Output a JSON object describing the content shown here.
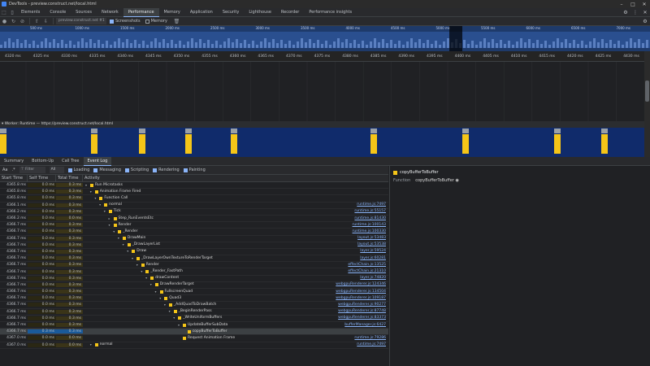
{
  "window": {
    "title": "DevTools - preview.construct.net/local.html"
  },
  "tabs": [
    "Elements",
    "Console",
    "Sources",
    "Network",
    "Performance",
    "Memory",
    "Application",
    "Security",
    "Lighthouse",
    "Recorder",
    "Performance insights"
  ],
  "active_tab": "Performance",
  "toolbar": {
    "url": "preview.construct.net #1",
    "screenshots_label": "Screenshots",
    "memory_label": "Memory"
  },
  "overview_ticks": [
    "500 ms",
    "1000 ms",
    "1500 ms",
    "2000 ms",
    "2500 ms",
    "3000 ms",
    "3500 ms",
    "4000 ms",
    "4500 ms",
    "5000 ms",
    "5500 ms",
    "6000 ms",
    "6500 ms",
    "7000 ms"
  ],
  "ruler_ticks": [
    "4320 ms",
    "4325 ms",
    "4330 ms",
    "4335 ms",
    "4340 ms",
    "4345 ms",
    "4350 ms",
    "4355 ms",
    "4360 ms",
    "4365 ms",
    "4370 ms",
    "4375 ms",
    "4380 ms",
    "4385 ms",
    "4390 ms",
    "4395 ms",
    "4400 ms",
    "4405 ms",
    "4410 ms",
    "4415 ms",
    "4420 ms",
    "4425 ms",
    "4430 ms"
  ],
  "worker_track": {
    "label": "Worker: Runtime — https://preview.construct.net/local.html"
  },
  "bottom_tabs": [
    "Summary",
    "Bottom-Up",
    "Call Tree",
    "Event Log"
  ],
  "active_bottom_tab": "Event Log",
  "filter": {
    "case_label": "Aa",
    "regex_label": ".*",
    "filter_placeholder": "Filter",
    "select_value": "All",
    "checks": [
      "Loading",
      "Messaging",
      "Scripting",
      "Rendering",
      "Painting"
    ]
  },
  "table": {
    "headers": [
      "Start Time",
      "Self Time",
      "Total Time",
      "Activity"
    ],
    "rows": [
      {
        "start": "4365.8 ms",
        "self": "0.0 ms",
        "total": "0.3 ms",
        "depth": 0,
        "name": "Run Microtasks",
        "src": ""
      },
      {
        "start": "4365.8 ms",
        "self": "0.0 ms",
        "total": "0.3 ms",
        "depth": 1,
        "name": "Animation Frame Fired",
        "src": ""
      },
      {
        "start": "4365.8 ms",
        "self": "0.0 ms",
        "total": "0.3 ms",
        "depth": 2,
        "name": "Function Call",
        "src": ""
      },
      {
        "start": "4366.1 ms",
        "self": "0.0 ms",
        "total": "0.3 ms",
        "depth": 3,
        "name": "normal",
        "src": "runtime.js:7497"
      },
      {
        "start": "4366.2 ms",
        "self": "0.0 ms",
        "total": "0.3 ms",
        "depth": 4,
        "name": "Tick",
        "src": "runtime.js:55157"
      },
      {
        "start": "4366.2 ms",
        "self": "0.0 ms",
        "total": "0.0 ms",
        "depth": 5,
        "name": "Step_RunEventsEtc",
        "src": "runtime.js:81430"
      },
      {
        "start": "4366.7 ms",
        "self": "0.0 ms",
        "total": "0.3 ms",
        "depth": 5,
        "name": "Render",
        "src": "runtime.js:100143"
      },
      {
        "start": "4366.7 ms",
        "self": "0.0 ms",
        "total": "0.3 ms",
        "depth": 6,
        "name": "_Render",
        "src": "runtime.js:100330"
      },
      {
        "start": "4366.7 ms",
        "self": "0.0 ms",
        "total": "0.3 ms",
        "depth": 7,
        "name": "DrawMain",
        "src": "layout.js:53483"
      },
      {
        "start": "4366.7 ms",
        "self": "0.0 ms",
        "total": "0.3 ms",
        "depth": 8,
        "name": "_DrawLayerList",
        "src": "layout.js:53538"
      },
      {
        "start": "4366.7 ms",
        "self": "0.0 ms",
        "total": "0.3 ms",
        "depth": 9,
        "name": "Draw",
        "src": "layer.js:59524"
      },
      {
        "start": "4366.7 ms",
        "self": "0.0 ms",
        "total": "0.3 ms",
        "depth": 10,
        "name": "_DrawLayerOwnTextureToRenderTarget",
        "src": "layer.js:60281"
      },
      {
        "start": "4366.7 ms",
        "self": "0.0 ms",
        "total": "0.3 ms",
        "depth": 11,
        "name": "Render",
        "src": "effectChain.js:13525"
      },
      {
        "start": "4366.7 ms",
        "self": "0.0 ms",
        "total": "0.3 ms",
        "depth": 12,
        "name": "_Render_FastPath",
        "src": "effectChain.js:21310"
      },
      {
        "start": "4366.7 ms",
        "self": "0.0 ms",
        "total": "0.3 ms",
        "depth": 13,
        "name": "drawContent",
        "src": "layer.js:74820"
      },
      {
        "start": "4366.7 ms",
        "self": "0.0 ms",
        "total": "0.3 ms",
        "depth": 14,
        "name": "DrawRenderTarget",
        "src": "webgpuRenderer.js:124346"
      },
      {
        "start": "4366.7 ms",
        "self": "0.0 ms",
        "total": "0.3 ms",
        "depth": 15,
        "name": "FullscreenQuad",
        "src": "webgpuRenderer.js:134504"
      },
      {
        "start": "4366.7 ms",
        "self": "0.0 ms",
        "total": "0.3 ms",
        "depth": 16,
        "name": "Quad3",
        "src": "webgpuRenderer.js:109187"
      },
      {
        "start": "4366.7 ms",
        "self": "0.0 ms",
        "total": "0.3 ms",
        "depth": 17,
        "name": "_AddQuadToDrawBatch",
        "src": "webgpuRenderer.js:90277"
      },
      {
        "start": "4366.7 ms",
        "self": "0.0 ms",
        "total": "0.3 ms",
        "depth": 18,
        "name": "_BeginRenderPass",
        "src": "webgpuRenderer.js:87748"
      },
      {
        "start": "4366.7 ms",
        "self": "0.0 ms",
        "total": "0.3 ms",
        "depth": 19,
        "name": "_WriteUniformBuffers",
        "src": "webgpuRenderer.js:83373"
      },
      {
        "start": "4366.7 ms",
        "self": "0.0 ms",
        "total": "0.3 ms",
        "depth": 20,
        "name": "UpdateBufferSubData",
        "src": "bufferManager.js:6427"
      },
      {
        "start": "4366.7 ms",
        "self": "0.3 ms",
        "total": "0.3 ms",
        "depth": 21,
        "name": "copyBufferToBuffer",
        "src": "",
        "selected": true
      },
      {
        "start": "4367.0 ms",
        "self": "0.0 ms",
        "total": "0.0 ms",
        "depth": 20,
        "name": "Request Animation Frame",
        "src": "runtime.js:79286"
      },
      {
        "start": "4367.0 ms",
        "self": "0.0 ms",
        "total": "0.0 ms",
        "depth": 1,
        "name": "normal",
        "src": "runtime.js:7497"
      }
    ]
  },
  "details": {
    "title": "copyBufferToBuffer",
    "function_label": "Function",
    "function_value": "copyBufferToBuffer"
  },
  "colors": {
    "accent": "#8ab4f8",
    "scripting": "#f5c518",
    "track_bg": "#102b6b"
  }
}
